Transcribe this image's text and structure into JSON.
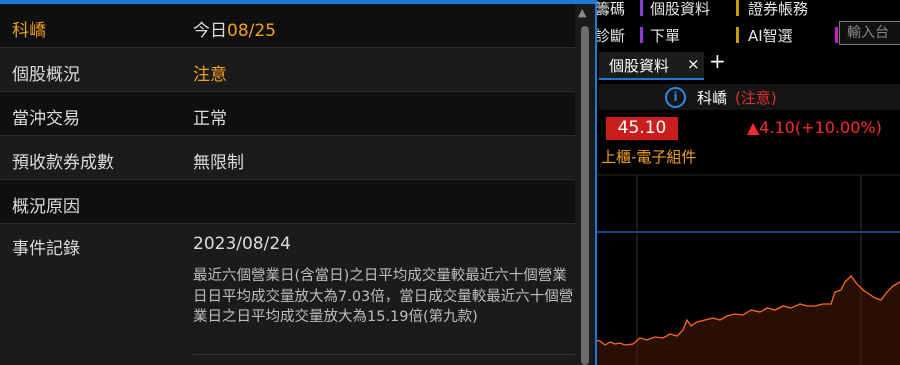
{
  "left_panel": {
    "rows": [
      {
        "label": "科嶠",
        "value_prefix": "今日",
        "value_accent": "08/25"
      },
      {
        "label": "個股概況",
        "value": "注意"
      },
      {
        "label": "當沖交易",
        "value": "正常"
      },
      {
        "label": "預收款券成數",
        "value": "無限制"
      },
      {
        "label": "概況原因",
        "value": ""
      }
    ],
    "event": {
      "label": "事件記錄",
      "date": "2023/08/24",
      "text": "最近六個營業日(含當日)之日平均成交量較最近六十個營業日日平均成交量放大為7.03倍，當日成交量較最近六十個營業日之日平均成交量放大為15.19倍(第九款)"
    }
  },
  "right_panel": {
    "menu": {
      "row1": [
        "籌碼",
        "個股資料",
        "證券帳務"
      ],
      "row2": [
        "診斷",
        "下單",
        "AI智選"
      ],
      "search_placeholder": "輸入台"
    },
    "tab": {
      "label": "個股資料",
      "close": "×",
      "add": "+"
    },
    "info": {
      "icon": "i",
      "name": "科嶠",
      "status": "(注意)"
    },
    "quote": {
      "price": "45.10",
      "change": "▲4.10(+10.00%)",
      "sector": "上櫃-電子組件"
    }
  },
  "colors": {
    "accent_blue": "#1e78d8",
    "up_red": "#e03030",
    "orange": "#f0a020"
  }
}
